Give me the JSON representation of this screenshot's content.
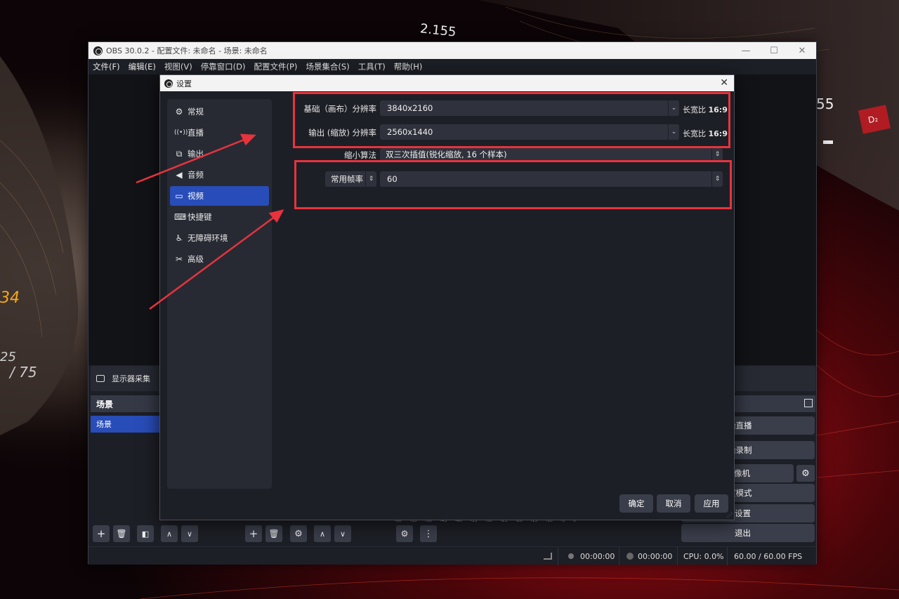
{
  "wallpaper": {
    "texts": [
      "2.155",
      "55",
      "D₂",
      "34",
      "25",
      "/ 75"
    ]
  },
  "obs": {
    "title": "OBS 30.0.2 - 配置文件: 未命名 - 场景: 未命名",
    "window_controls": [
      "—",
      "☐",
      "✕"
    ],
    "menu": [
      "文件(F)",
      "编辑(E)",
      "视图(V)",
      "停靠窗口(D)",
      "配置文件(P)",
      "场景集合(S)",
      "工具(T)",
      "帮助(H)"
    ],
    "source_bar_label": "显示器采集",
    "scenes": {
      "header": "场景",
      "items": [
        "场景"
      ]
    },
    "audio_meter_ticks": [
      "-60",
      "-55",
      "-50",
      "-45",
      "-40",
      "-35",
      "-30",
      "-25",
      "-20",
      "-15",
      "-10",
      "-5",
      "0"
    ],
    "controls": {
      "start_stream": "开始直播",
      "start_record": "开始录制",
      "virtual_cam": "拟摄像机",
      "studio_mode": "作室模式",
      "settings": "设置",
      "exit": "退出"
    },
    "status": {
      "stream_time": "00:00:00",
      "record_time": "00:00:00",
      "cpu": "CPU: 0.0%",
      "fps": "60.00 / 60.00 FPS"
    }
  },
  "settings": {
    "title": "设置",
    "nav": [
      {
        "label": "常规",
        "icon": "gear-icon"
      },
      {
        "label": "直播",
        "icon": "broadcast-icon"
      },
      {
        "label": "输出",
        "icon": "output-icon"
      },
      {
        "label": "音频",
        "icon": "speaker-icon"
      },
      {
        "label": "视频",
        "icon": "monitor-icon",
        "active": true
      },
      {
        "label": "快捷键",
        "icon": "keyboard-icon"
      },
      {
        "label": "无障碍环境",
        "icon": "accessibility-icon"
      },
      {
        "label": "高级",
        "icon": "tools-icon"
      }
    ],
    "video": {
      "base_res_label": "基础（画布）分辨率",
      "base_res_value": "3840x2160",
      "base_aspect_label": "长宽比",
      "base_aspect_value": "16:9",
      "output_res_label": "输出 (缩放) 分辨率",
      "output_res_value": "2560x1440",
      "output_aspect_label": "长宽比",
      "output_aspect_value": "16:9",
      "downscale_label": "缩小算法",
      "downscale_value": "双三次插值(锐化缩放, 16 个样本)",
      "fps_type": "常用帧率",
      "fps_value": "60"
    },
    "buttons": {
      "ok": "确定",
      "cancel": "取消",
      "apply": "应用"
    }
  },
  "colors": {
    "annotation_red": "#e8333d",
    "accent_blue": "#284cb8",
    "panel_bg": "#1d1f26"
  }
}
